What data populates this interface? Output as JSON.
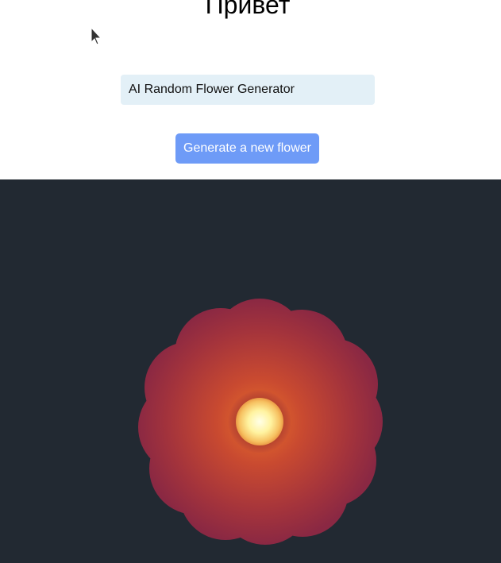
{
  "header": {
    "title": "Привет"
  },
  "input": {
    "value": "AI Random Flower Generator"
  },
  "generate_button": {
    "label": "Generate a new flower"
  },
  "canvas": {
    "background": "#222932"
  },
  "flower": {
    "petal_color_edge": "#8f2842",
    "petal_color_inner": "#c94a30",
    "center_glow": "#fff6b0"
  },
  "icons": {
    "cursor": "mouse-pointer-icon"
  }
}
